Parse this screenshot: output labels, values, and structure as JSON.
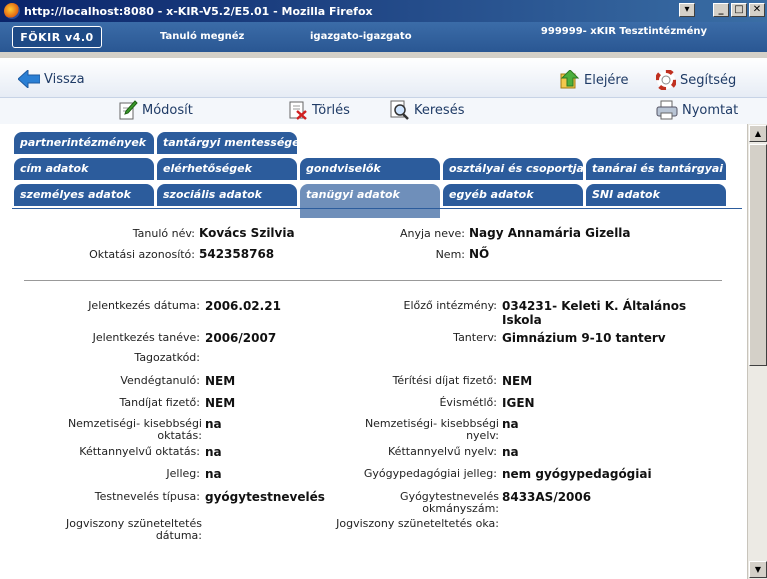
{
  "window": {
    "title": "http://localhost:8080 - x-KIR-V5.2/E5.01 - Mozilla Firefox"
  },
  "header": {
    "logo": "FÖKIR v4.0",
    "page": "Tanuló megnéz",
    "user": "igazgato-igazgato",
    "institution": "999999- xKIR Tesztintézmény"
  },
  "toolbar": {
    "back": "Vissza",
    "home": "Elejére",
    "help": "Segítség",
    "edit": "Módosít",
    "delete": "Törlés",
    "search": "Keresés",
    "print": "Nyomtat"
  },
  "tabs": {
    "partner": "partnerintézmények",
    "exemption": "tantárgyi mentességek",
    "address": "cím adatok",
    "contacts": "elérhetőségek",
    "guardians": "gondviselők",
    "classes": "osztályai és csoportjai",
    "teachers": "tanárai és tantárgyai",
    "personal": "személyes adatok",
    "social": "szociális adatok",
    "academic": "tanügyi adatok",
    "other": "egyéb adatok",
    "sni": "SNI adatok"
  },
  "student": {
    "name_label": "Tanuló név:",
    "name": "Kovács Szilvia",
    "mother_label": "Anyja neve:",
    "mother": "Nagy Annamária Gizella",
    "id_label": "Oktatási azonosító:",
    "id": "542358768",
    "sex_label": "Nem:",
    "sex": "NŐ"
  },
  "details": {
    "apply_date_label": "Jelentkezés dátuma:",
    "apply_date": "2006.02.21",
    "prev_school_label": "Előző intézmény:",
    "prev_school_1": "034231- Keleti K. Általános",
    "prev_school_2": "Iskola",
    "apply_year_label": "Jelentkezés tanéve:",
    "apply_year": "2006/2007",
    "curriculum_label": "Tanterv:",
    "curriculum": "Gimnázium 9-10 tanterv",
    "section_code_label": "Tagozatkód:",
    "guest_label": "Vendégtanuló:",
    "guest": "NEM",
    "fee_payer_label": "Térítési díjat fizető:",
    "fee_payer": "NEM",
    "tuition_label": "Tandíjat fizető:",
    "tuition": "NEM",
    "repeater_label": "Évismétlő:",
    "repeater": "IGEN",
    "minority_edu_label_1": "Nemzetiségi- kisebbségi",
    "minority_edu_label_2": "oktatás:",
    "minority_edu": "na",
    "minority_lang_label_1": "Nemzetiségi- kisebbségi",
    "minority_lang_label_2": "nyelv:",
    "minority_lang": "na",
    "bilingual_edu_label": "Kéttannyelvű oktatás:",
    "bilingual_edu": "na",
    "bilingual_lang_label": "Kéttannyelvű nyelv:",
    "bilingual_lang": "na",
    "nature_label": "Jelleg:",
    "nature": "na",
    "special_label": "Gyógypedagógiai jelleg:",
    "special": "nem gyógypedagógiai",
    "pe_type_label": "Testnevelés típusa:",
    "pe_type": "gyógytestnevelés",
    "corr_pe_label_1": "Gyógytestnevelés",
    "corr_pe_label_2": "okmányszám:",
    "corr_pe": "8433AS/2006",
    "susp_date_label_1": "Jogviszony szüneteltetés",
    "susp_date_label_2": "dátuma:",
    "susp_reason_label": "Jogviszony szüneteltetés oka:"
  }
}
